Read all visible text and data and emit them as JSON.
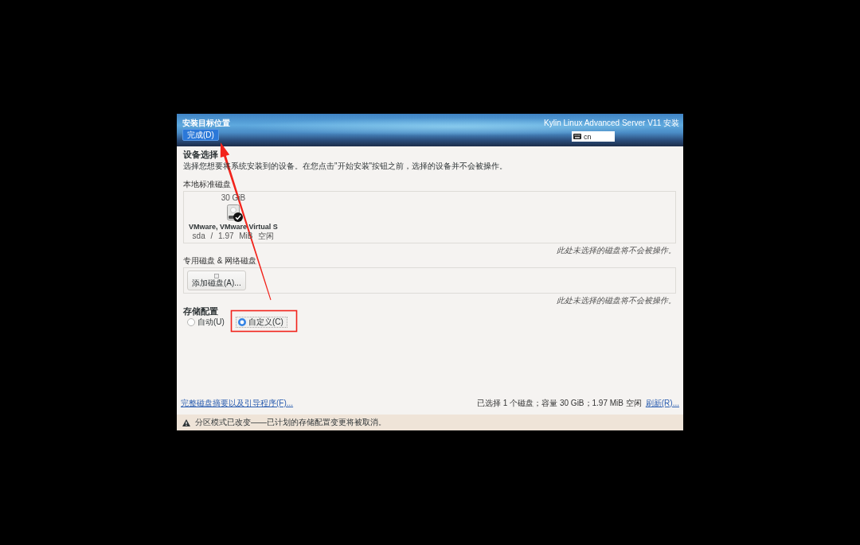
{
  "window": {
    "title": "安装目标位置",
    "done_button": "完成(D)",
    "product": "Kylin Linux Advanced Server V11 安装",
    "keyboard_layout": "cn"
  },
  "device_selection": {
    "heading": "设备选择",
    "description": "选择您想要将系统安装到的设备。在您点击\"开始安装\"按钮之前，选择的设备并不会被操作。",
    "local_disks": {
      "label": "本地标准磁盘",
      "disks": [
        {
          "size": "30 GiB",
          "name": "VMware, VMware Virtual S",
          "details": "sda / 1.97 MiB 空闲",
          "selected": true
        }
      ],
      "note": "此处未选择的磁盘将不会被操作。"
    },
    "specialized_disks": {
      "label": "专用磁盘 & 网络磁盘",
      "add_button": "添加磁盘(A)...",
      "note": "此处未选择的磁盘将不会被操作。"
    }
  },
  "storage_configuration": {
    "heading": "存储配置",
    "options": [
      {
        "label": "自动(U)",
        "selected": false,
        "focused": false
      },
      {
        "label": "自定义(C)",
        "selected": true,
        "focused": true
      }
    ]
  },
  "footer": {
    "summary_link": "完整磁盘摘要以及引导程序(F)...",
    "status": "已选择 1 个磁盘；容量 30 GiB；1.97 MiB 空闲",
    "refresh_link": "刷新(R)..."
  },
  "warning": {
    "text": "分区模式已改变——已计划的存储配置变更将被取消。"
  }
}
